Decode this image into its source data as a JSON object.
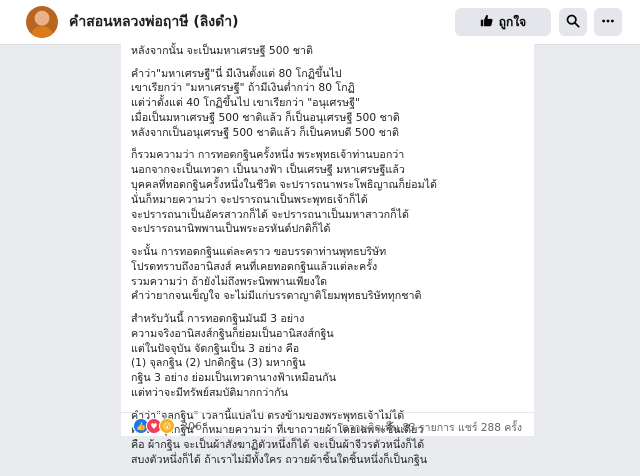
{
  "header": {
    "page_name": "คำสอนหลวงพ่อฤาษี (ลิงดำ)",
    "like_label": "ถูกใจ",
    "like_icon": "thumbs-up-icon",
    "search_icon": "search-icon",
    "more_icon": "more-icon"
  },
  "post": {
    "paragraphs": [
      [
        "หลังจากนั้น จะเป็นมหาเศรษฐี 500 ชาติ"
      ],
      [
        "คำว่า\"มหาเศรษฐี\"นี่ มีเงินตั้งแต่ 80 โกฏิขึ้นไป",
        "เขาเรียกว่า \"มหาเศรษฐี\" ถ้ามีเงินต่ำกว่า 80 โกฏิ",
        "แต่ว่าตั้งแต่ 40 โกฏิขึ้นไป เขาเรียกว่า \"อนุเศรษฐี\"",
        "เมื่อเป็นมหาเศรษฐี 500 ชาติแล้ว ก็เป็นอนุเศรษฐี 500 ชาติ",
        "หลังจากเป็นอนุเศรษฐี 500 ชาติแล้ว ก็เป็นคหบดี 500 ชาติ"
      ],
      [
        "ก็รวมความว่า การทอดกฐินครั้งหนึ่ง พระพุทธเจ้าท่านบอกว่า",
        "นอกจากจะเป็นเทวดา เป็นนางฟ้า เป็นเศรษฐี มหาเศรษฐีแล้ว",
        "บุคคลที่ทอดกฐินครั้งหนึ่งในชีวิต จะปรารถนาพระโพธิญาณก็ย่อมได้",
        "นั่นก็หมายความว่า จะปรารถนาเป็นพระพุทธเจ้าก็ได้",
        "จะปรารถนาเป็นอัครสาวกก็ได้ จะปรารถนาเป็นมหาสาวกก็ได้",
        "จะปรารถนานิพพานเป็นพระอรหันต์ปกติก็ได้"
      ],
      [
        "จะนั้น การทอดกฐินแต่ละคราว ขอบรรดาท่านพุทธบริษัท",
        "โปรดทราบถึงอานิสงส์ คนที่เคยทอดกฐินแล้วแต่ละครั้ง",
        "รวมความว่า ถ้ายังไม่ถึงพระนิพพานเพียงใด",
        "คำว่ายากจนเข็ญใจ จะไม่มีแก่บรรดาญาติโยมพุทธบริษัททุกชาติ"
      ],
      [
        "สำหรับวันนี้ การทอดกฐินมันมี 3 อย่าง",
        "ความจริงอานิสงส์กฐินก็ย่อมเป็นอานิสงส์กฐิน",
        "แต่ในปัจจุบัน จัดกฐินเป็น 3 อย่าง คือ",
        "(1) จุลกฐิน (2) ปกติกฐิน (3) มหากฐิน",
        "กฐิน 3 อย่าง ย่อมเป็นเทวดานางฟ้าเหมือนกัน",
        "แต่ทว่าจะมีทรัพย์สมบัติมากกว่ากัน"
      ],
      [
        "คำว่า\"จุลกฐิน\" เวลานี้แปลไป ตรงข้ามของพระพุทธเจ้าไม่ได้",
        "คำว่า\"จุลกฐิน\" ก็หมายความว่า ที่เขาถวายผ้าโดยเฉพาะชิ้นเดียว",
        "คือ ผ้ากฐิน จะเป็นผ้าสังฆาฏิตัวหนึ่งก็ได้ จะเป็นผ้าจีวรตัวหนึ่งก็ได้",
        "สบงตัวหนึ่งก็ได้ ถ้าเราไม่มีทั้งใคร ถวายผ้าชิ้นใดชิ้นหนึ่งก็เป็นกฐิน"
      ]
    ],
    "reaction_count": "306",
    "comments_shares": "ความคิดเห็น 83 รายการ  แชร์ 288 ครั้ง",
    "reaction_icons": [
      "like-reaction-icon",
      "love-reaction-icon",
      "wow-reaction-icon"
    ]
  },
  "colors": {
    "background": "#e9ebee",
    "card": "#ffffff",
    "button": "#e4e6eb",
    "like_blue": "#1877f2",
    "love_red": "#f33e58",
    "wow_yellow": "#f7b125"
  }
}
